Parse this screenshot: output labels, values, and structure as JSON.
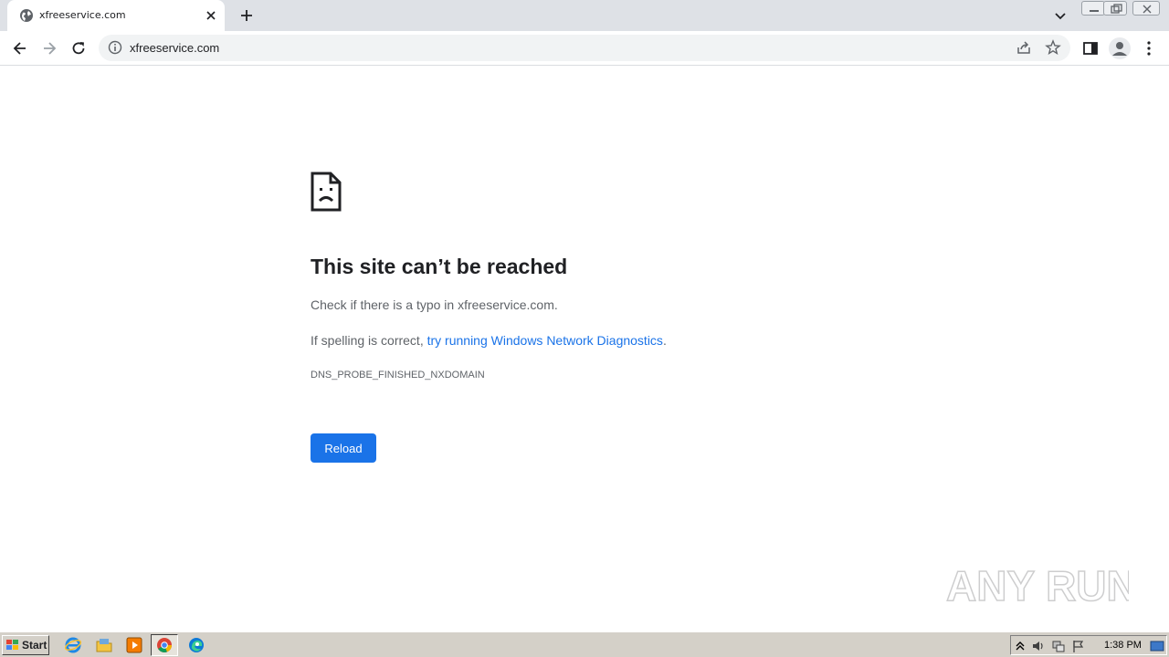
{
  "browser": {
    "tab": {
      "title": "xfreeservice.com"
    },
    "address_bar": {
      "url": "xfreeservice.com"
    }
  },
  "error_page": {
    "title": "This site can’t be reached",
    "line1": "Check if there is a typo in xfreeservice.com.",
    "line2_prefix": "If spelling is correct, ",
    "line2_link": "try running Windows Network Diagnostics",
    "line2_suffix": ".",
    "error_code": "DNS_PROBE_FINISHED_NXDOMAIN",
    "reload_label": "Reload"
  },
  "watermark": {
    "text": "ANY RUN"
  },
  "taskbar": {
    "start_label": "Start",
    "clock": "1:38 PM",
    "apps": [
      "internet-explorer-icon",
      "folder-icon",
      "media-player-icon",
      "chrome-icon",
      "edge-icon"
    ]
  },
  "colors": {
    "accent": "#1a73e8",
    "tabstrip": "#dee1e6",
    "taskbar": "#d4d0c8"
  }
}
